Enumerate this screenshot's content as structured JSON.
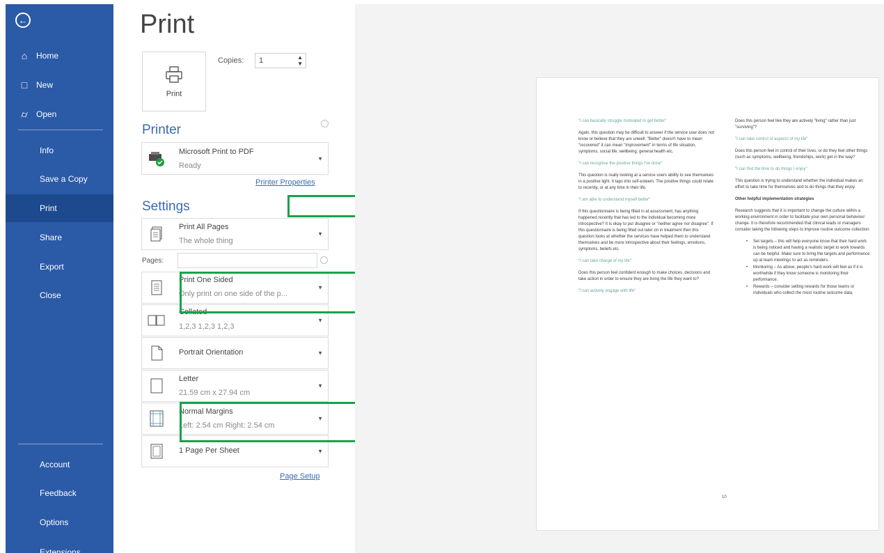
{
  "sidebar": {
    "back_icon": "back-arrow-icon",
    "home": "Home",
    "new": "New",
    "open": "Open",
    "info": "Info",
    "save_copy": "Save a Copy",
    "print": "Print",
    "share": "Share",
    "export": "Export",
    "close": "Close",
    "account": "Account",
    "feedback": "Feedback",
    "options": "Options",
    "extensions": "Extensions"
  },
  "title": "Print",
  "print_button": "Print",
  "copies": {
    "label": "Copies:",
    "value": "1"
  },
  "printer": {
    "heading": "Printer",
    "name": "Microsoft Print to PDF",
    "status": "Ready",
    "properties_link": "Printer Properties"
  },
  "settings": {
    "heading": "Settings",
    "pages_label": "Pages:",
    "items": [
      {
        "title": "Print All Pages",
        "sub": "The whole thing"
      },
      {
        "title": "Print One Sided",
        "sub": "Only print on one side of the p..."
      },
      {
        "title": "Collated",
        "sub": "1,2,3    1,2,3    1,2,3"
      },
      {
        "title": "Portrait Orientation",
        "sub": ""
      },
      {
        "title": "Letter",
        "sub": "21.59 cm x 27.94 cm"
      },
      {
        "title": "Normal Margins",
        "sub": "Left:  2.54 cm    Right:  2.54 cm"
      },
      {
        "title": "1 Page Per Sheet",
        "sub": ""
      }
    ],
    "page_setup_link": "Page Setup"
  },
  "preview": {
    "left": [
      {
        "type": "quote",
        "text": "\"I can basically struggle motivated to get better\""
      },
      {
        "type": "body",
        "text": "Again, this question may be difficult to answer if the service user does not know or believe that they are unwell. \"Better\" doesn't have to mean \"recovered\" it can mean \"improvement\" in terms of life situation, symptoms, social life, wellbeing, general health etc."
      },
      {
        "type": "quote",
        "text": "\"I can recognise the positive things I've done\""
      },
      {
        "type": "body",
        "text": "This question is really looking at a service users ability to see themselves in a positive light. It taps into self-esteem. The positive things could relate to recently, or at any time in their life."
      },
      {
        "type": "quote",
        "text": "\"I am able to understand myself better\""
      },
      {
        "type": "body",
        "text": "If this questionnaire is being filled in at assessment, has anything happened recently that has led to the individual becoming more introspective? It is okay to put disagree or \"neither agree nor disagree\". If this questionnaire is being filled out later on in treatment then this question looks at whether the services have helped them to understand themselves and be more introspective about their feelings, emotions, symptoms, beliefs etc."
      },
      {
        "type": "quote",
        "text": "\"I can take charge of my life\""
      },
      {
        "type": "body",
        "text": "Does this person feel confident enough to make choices, decisions and take action in order to ensure they are living the life they want to?"
      },
      {
        "type": "quote",
        "text": "\"I can actively engage with life\""
      }
    ],
    "right": [
      {
        "type": "body",
        "text": "Does this person feel like they are actively \"living\" rather than just \"surviving\"?"
      },
      {
        "type": "quote",
        "text": "\"I can take control of aspects of my life\""
      },
      {
        "type": "body",
        "text": "Does this person feel in control of their lives, or do they feel other things (such as symptoms, wellbeing, friendships, work) get in the way?"
      },
      {
        "type": "quote",
        "text": "\"I can find the time to do things I enjoy\""
      },
      {
        "type": "body",
        "text": "This question is trying to understand whether the individual makes an effort to take time for themselves and to do things that they enjoy."
      },
      {
        "type": "bold",
        "text": "Other helpful implementation strategies"
      },
      {
        "type": "body",
        "text": "Research suggests that it is important to change the culture within a working environment in order to facilitate your own personal behaviour change. It is therefore recommended that clinical leads or managers consider taking the following steps to improve routine outcome collection:"
      }
    ],
    "bullets": [
      "Set targets – this will help everyone know that their hard work is being noticed and having a realistic target to work towards can be helpful. Make sure to bring the targets and performance up at team meetings to act as reminders.",
      "Monitoring – As above, people's hard work will feel as if it is worthwhile if they know someone is monitoring their performance.",
      "Rewards – consider setting rewards for those teams or individuals who collect the most routine outcome data."
    ],
    "page_number": "10"
  },
  "colors": {
    "sidebar": "#2b5aa7",
    "accent": "#3a6ab0",
    "highlight": "#16a34a"
  }
}
